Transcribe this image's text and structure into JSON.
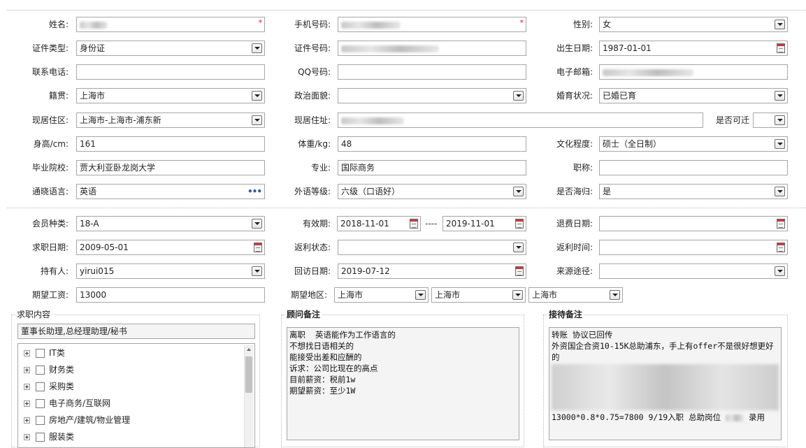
{
  "form": {
    "name_label": "姓名:",
    "name_req": "*",
    "phone_label": "手机号码:",
    "phone_req": "*",
    "gender_label": "性别:",
    "gender_value": "女",
    "idtype_label": "证件类型:",
    "idtype_value": "身份证",
    "idno_label": "证件号码:",
    "birth_label": "出生日期:",
    "birth_value": "1987-01-01",
    "contact_label": "联系电话:",
    "qq_label": "QQ号码:",
    "email_label": "电子邮箱:",
    "native_label": "籍贯:",
    "native_value": "上海市",
    "political_label": "政治面貌:",
    "marital_label": "婚育状况:",
    "marital_value": "已婚已育",
    "residence_label": "现居住区:",
    "residence_value": "上海市-上海市-浦东新",
    "address_label": "现居住址:",
    "relocate_label": "是否可迁",
    "height_label": "身高/cm:",
    "height_value": "161",
    "weight_label": "体重/kg:",
    "weight_value": "48",
    "education_label": "文化程度:",
    "education_value": "硕士（全日制）",
    "school_label": "毕业院校:",
    "school_value": "贾大利亚卧龙岗大学",
    "major_label": "专业:",
    "major_value": "国际商务",
    "title_label": "职称:",
    "language_label": "通晓语言:",
    "language_value": "英语",
    "langlevel_label": "外语等级:",
    "langlevel_value": "六级（口语好）",
    "overseas_label": "是否海归:",
    "overseas_value": "是"
  },
  "member": {
    "type_label": "会员种类:",
    "type_value": "18-A",
    "valid_label": "有效期:",
    "valid_from": "2018-11-01",
    "valid_sep": "----",
    "valid_to": "2019-11-01",
    "refund_label": "退费日期:",
    "jobdate_label": "求职日期:",
    "jobdate_value": "2009-05-01",
    "rebate_status_label": "返利状态:",
    "rebate_time_label": "返利时间:",
    "holder_label": "持有人:",
    "holder_value": "yirui015",
    "visit_label": "回访日期:",
    "visit_value": "2019-07-12",
    "source_label": "来源途径:",
    "salary_label": "期望工资:",
    "salary_value": "13000",
    "region_label": "期望地区:",
    "region1": "上海市",
    "region2": "上海市",
    "region3": "上海市"
  },
  "job_panel": {
    "title": "求职内容",
    "selected": "董事长助理,总经理助理/秘书",
    "items": [
      "IT类",
      "财务类",
      "采购类",
      "电子商务/互联网",
      "房地产/建筑/物业管理",
      "服装类"
    ]
  },
  "advisor_panel": {
    "title": "顾问备注",
    "lines": [
      "离职  英语能作为工作语言的",
      "不想找日语相关的",
      "能接受出差和应酬的",
      "诉求：公司比现在的高点",
      "目前薪资：税前1w",
      "期望薪资：至少1W"
    ]
  },
  "reception_panel": {
    "title": "接待备注",
    "lines": [
      "转账 协议已回传",
      "外资国企合资10-15K总助浦东，手上有offer不是很好想更好的"
    ],
    "last_line_a": "13000*0.8*0.75=7800 9/19入职 总助岗位",
    "last_line_b": "录用"
  },
  "icons": {
    "dropdown": "chevron-down-icon",
    "calendar": "calendar-icon",
    "more": "ellipsis-icon",
    "expand": "plus-box-icon",
    "checkbox": "checkbox-icon"
  },
  "colors": {
    "required": "#e02020",
    "border": "#a6a6a6",
    "link": "#2c5aa0"
  }
}
